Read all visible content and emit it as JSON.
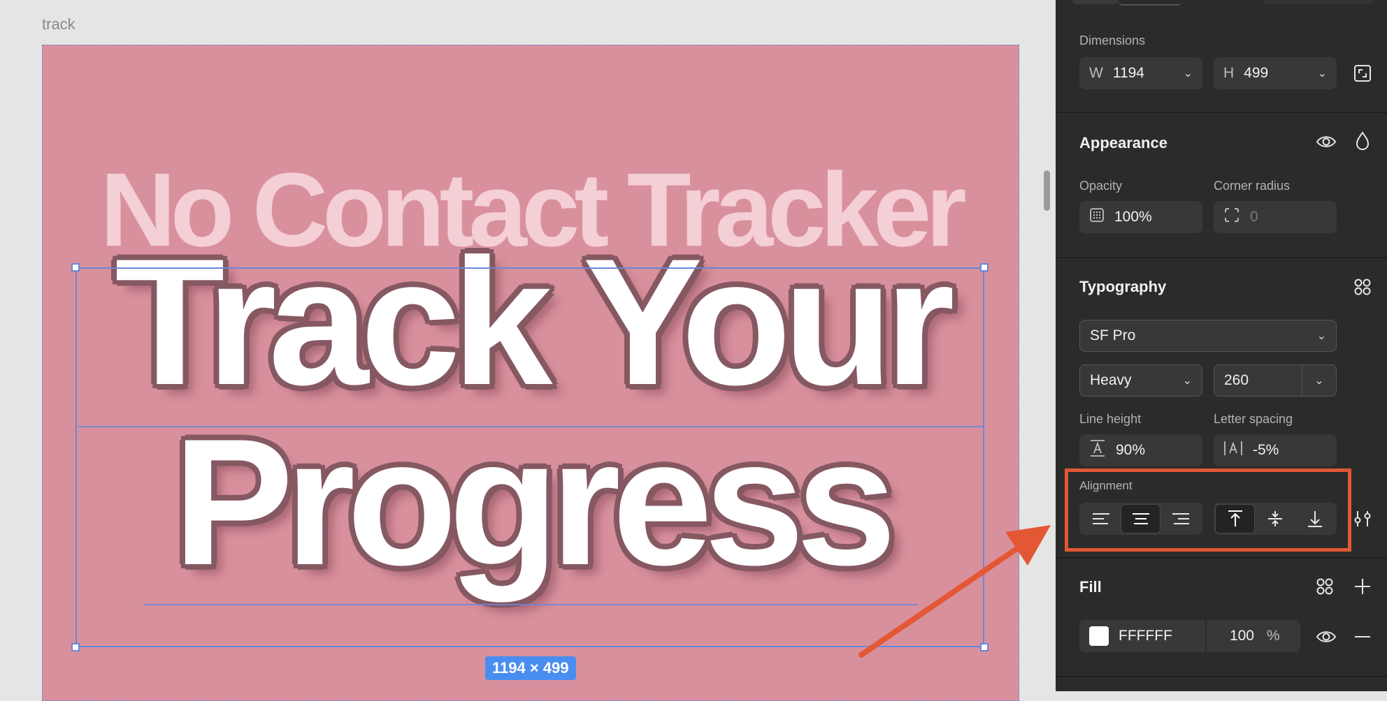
{
  "canvas": {
    "frame_label": "track",
    "subtitle": "No Contact Tracker",
    "headline_line1": "Track Your",
    "headline_line2": "Progress",
    "size_badge": "1194 × 499"
  },
  "dimensions": {
    "label": "Dimensions",
    "width_prefix": "W",
    "width": "1194",
    "height_prefix": "H",
    "height": "499"
  },
  "appearance": {
    "title": "Appearance",
    "opacity_label": "Opacity",
    "opacity": "100%",
    "corner_radius_label": "Corner radius",
    "corner_radius": "0"
  },
  "typography": {
    "title": "Typography",
    "font_family": "SF Pro",
    "font_weight": "Heavy",
    "font_size": "260",
    "line_height_label": "Line height",
    "line_height": "90%",
    "letter_spacing_label": "Letter spacing",
    "letter_spacing": "-5%",
    "alignment_label": "Alignment"
  },
  "fill": {
    "title": "Fill",
    "hex": "FFFFFF",
    "opacity": "100",
    "percent": "%"
  },
  "colors": {
    "artboard": "#d9909d",
    "panel": "#2b2b2b",
    "accent": "#4a8df0",
    "highlight": "#e35735"
  }
}
